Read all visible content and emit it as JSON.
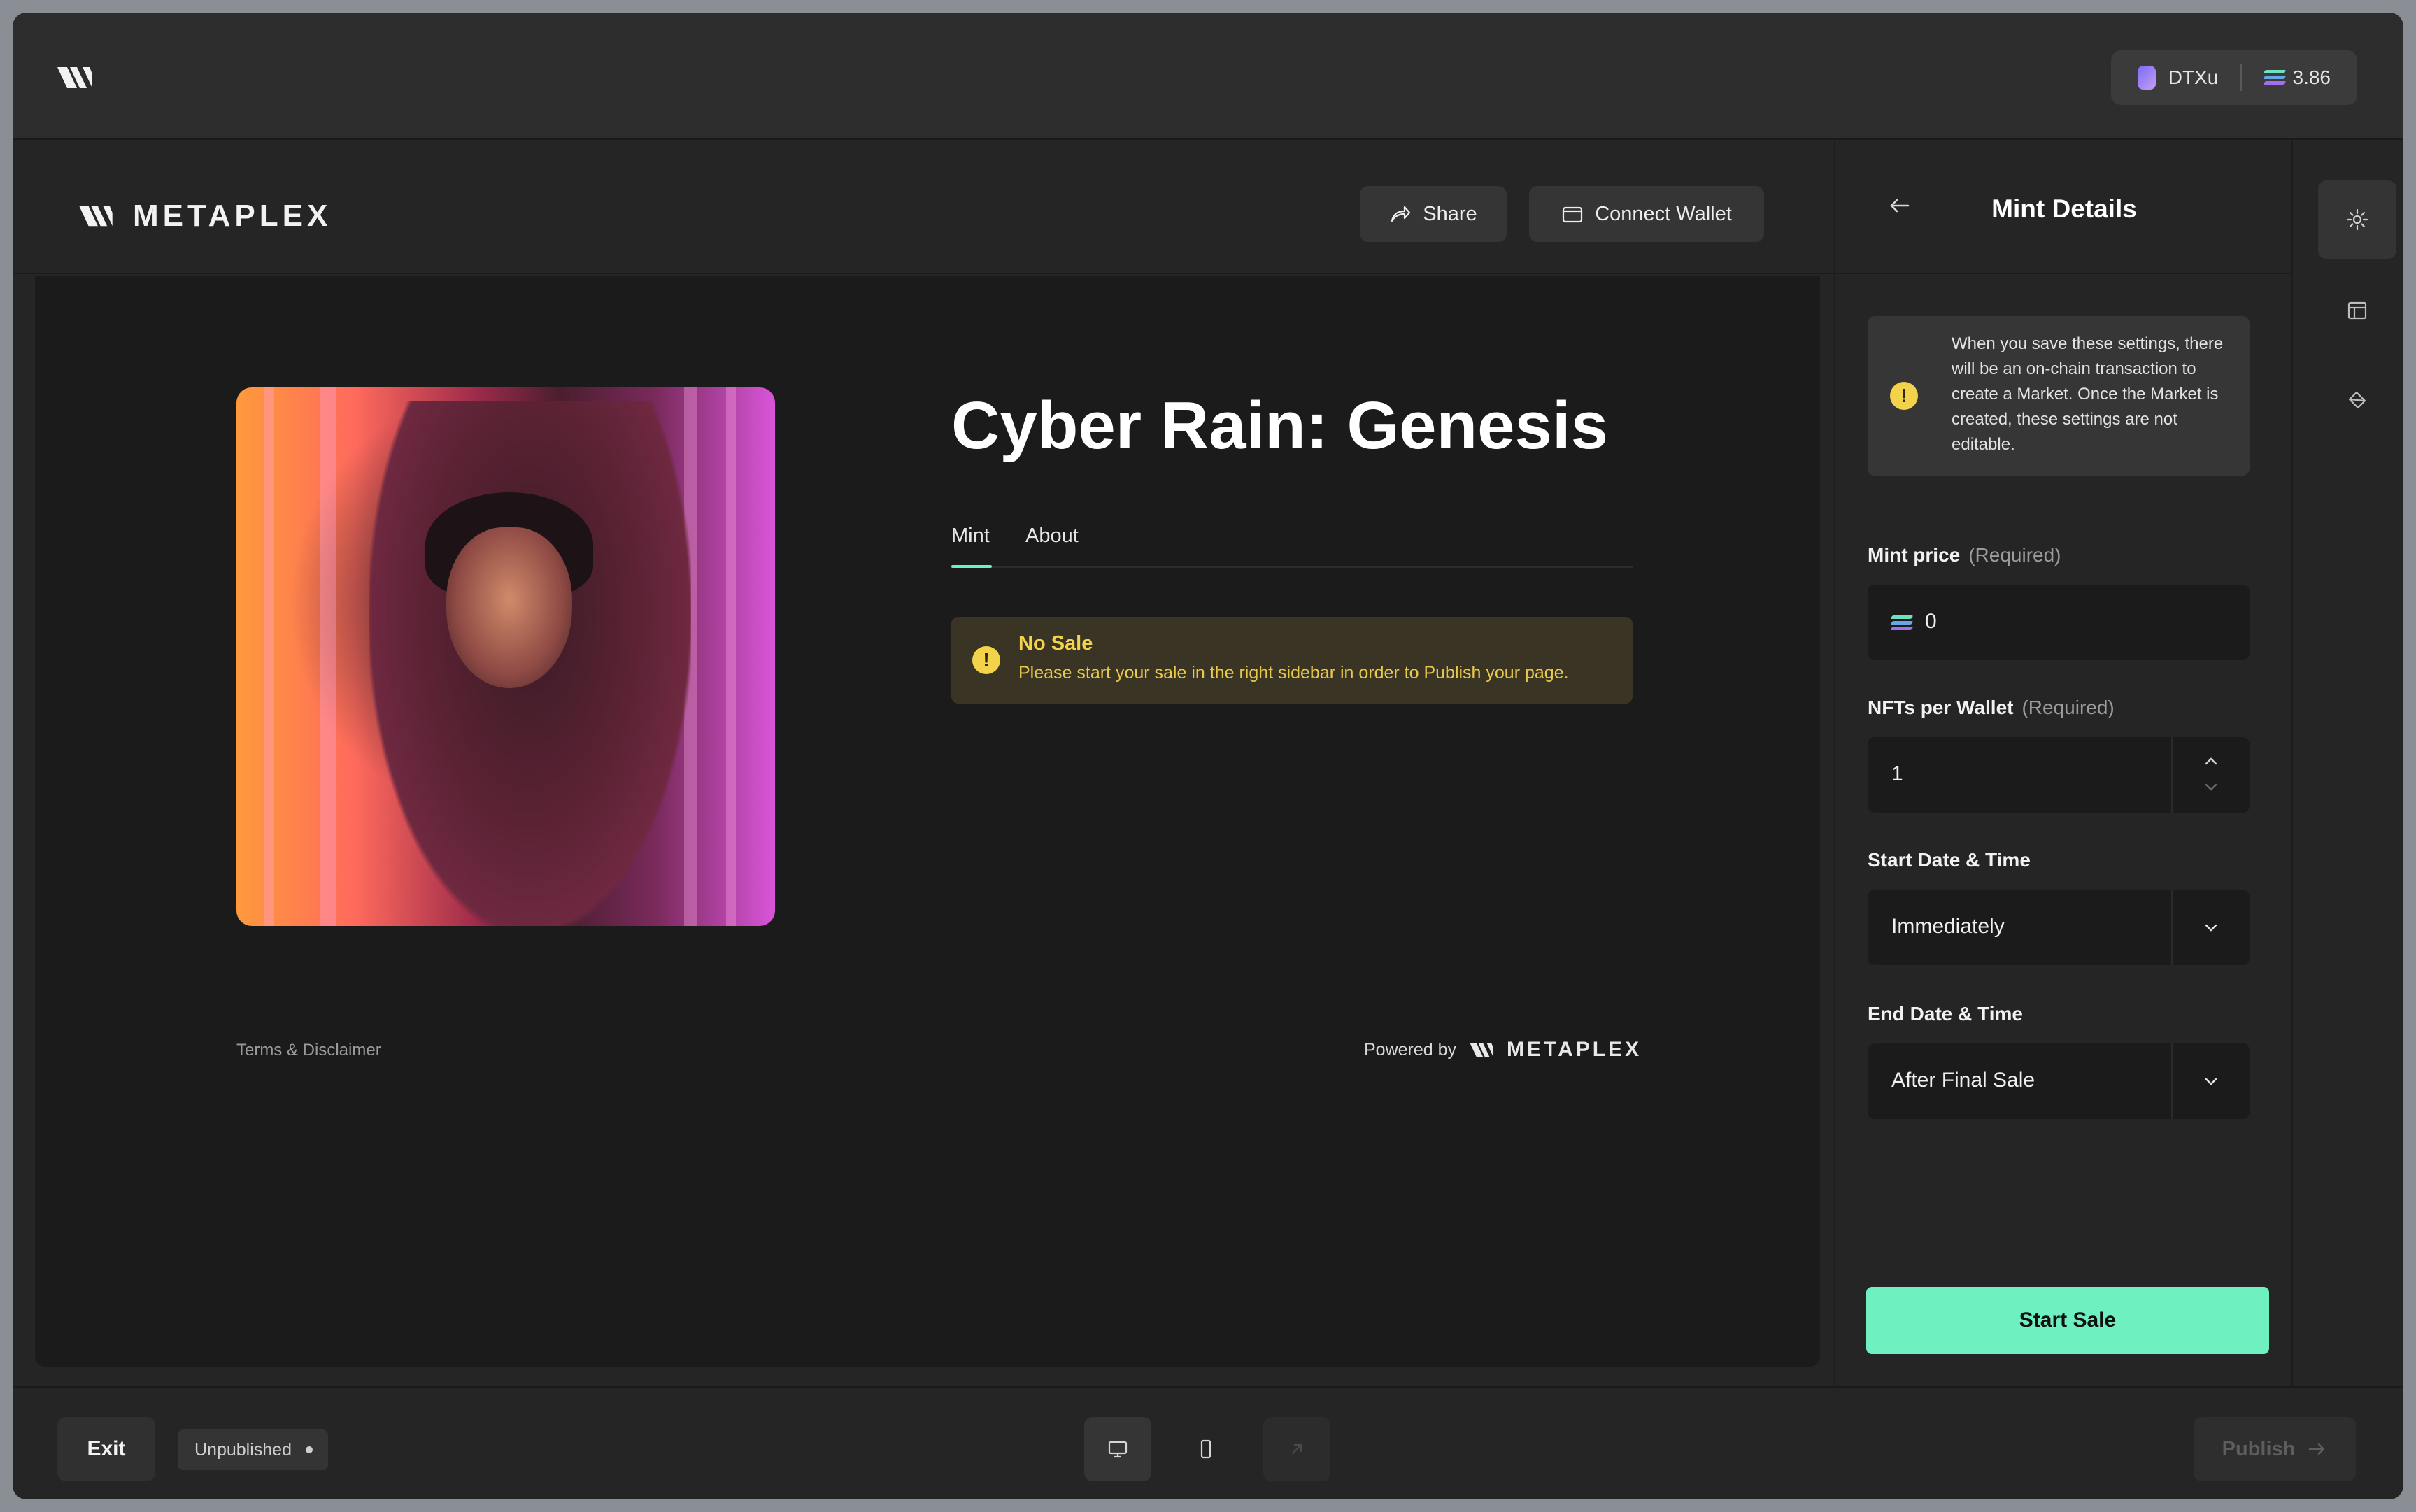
{
  "topbar": {
    "wallet": {
      "name": "DTXu",
      "balance": "3.86"
    }
  },
  "header": {
    "brand": "METAPLEX",
    "share_label": "Share",
    "connect_label": "Connect Wallet"
  },
  "main": {
    "title": "Cyber Rain: Genesis",
    "tabs": [
      {
        "label": "Mint",
        "active": true
      },
      {
        "label": "About",
        "active": false
      }
    ],
    "alert": {
      "title": "No Sale",
      "message": "Please start your sale in the right sidebar in order to Publish your page."
    },
    "footer": {
      "terms": "Terms & Disclaimer",
      "powered_by": "Powered by",
      "brand": "METAPLEX"
    }
  },
  "sidebar": {
    "title": "Mint Details",
    "info": "When you save these settings, there will be an on-chain transaction to create a Market. Once the Market is created, these settings are not editable.",
    "mint_price": {
      "label": "Mint price",
      "required": "(Required)",
      "value": "0"
    },
    "nfts_per_wallet": {
      "label": "NFTs per Wallet",
      "required": "(Required)",
      "value": "1"
    },
    "start": {
      "label": "Start Date & Time",
      "value": "Immediately"
    },
    "end": {
      "label": "End Date & Time",
      "value": "After Final Sale"
    },
    "start_sale_label": "Start Sale"
  },
  "bottombar": {
    "exit_label": "Exit",
    "status": "Unpublished",
    "publish_label": "Publish"
  },
  "colors": {
    "accent": "#6ff0c0",
    "warning": "#f2d34a",
    "background": "#1b1b1b"
  }
}
